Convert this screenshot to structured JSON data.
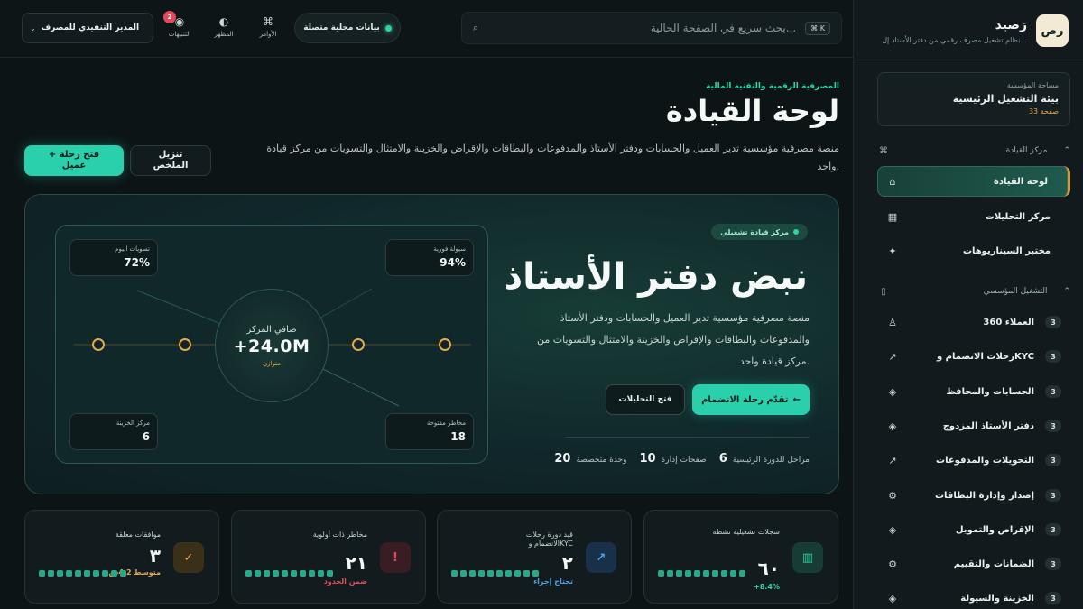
{
  "brand": {
    "name": "رَصيد",
    "logo": "رص",
    "subtitle": "نظام تشغيل مصرف رقمي من دفتر الأستاذ إل..."
  },
  "workspace": {
    "label": "مساحة المؤسسة",
    "name": "بيئة التشغيل الرئيسية",
    "count": "33 صفحة"
  },
  "sidebar": {
    "section_command": {
      "label": "مركز القيادة",
      "icon": "command-icon"
    },
    "command_items": [
      {
        "label": "لوحة القيادة",
        "icon": "dashboard-icon",
        "glyph": "⌂",
        "active": true
      },
      {
        "label": "مركز التحليلات",
        "icon": "analytics-icon",
        "glyph": "▦"
      },
      {
        "label": "مختبر السيناريوهات",
        "icon": "sparkle-icon",
        "glyph": "✦"
      }
    ],
    "section_ops": {
      "label": "التشغيل المؤسسي",
      "icon": "building-icon"
    },
    "ops_items": [
      {
        "label": "العملاء 360",
        "badge": "3",
        "icon": "user-icon",
        "glyph": "♙"
      },
      {
        "label": "رحلات الانضمام وKYC",
        "badge": "3",
        "icon": "arrow-up-right-icon",
        "glyph": "↗"
      },
      {
        "label": "الحسابات والمحافظ",
        "badge": "3",
        "icon": "diamond-icon",
        "glyph": "◈"
      },
      {
        "label": "دفتر الأستاذ المزدوج",
        "badge": "3",
        "icon": "diamond-icon",
        "glyph": "◈"
      },
      {
        "label": "التحويلات والمدفوعات",
        "badge": "3",
        "icon": "arrow-up-right-icon",
        "glyph": "↗"
      },
      {
        "label": "إصدار وإدارة البطاقات",
        "badge": "3",
        "icon": "gear-icon",
        "glyph": "⚙"
      },
      {
        "label": "الإقراض والتمويل",
        "badge": "3",
        "icon": "diamond-icon",
        "glyph": "◈"
      },
      {
        "label": "الضمانات والتقييم",
        "badge": "3",
        "icon": "gear-icon",
        "glyph": "⚙"
      },
      {
        "label": "الخزينة والسيولة",
        "badge": "3",
        "icon": "diamond-icon",
        "glyph": "◈"
      }
    ]
  },
  "topbar": {
    "search_placeholder": "بحث سريع في الصفحة الحالية...",
    "search_shortcut": "⌘ K",
    "live_data_label": "بيانات محلية متصلة",
    "commands_label": "الأوامر",
    "appearance_label": "المظهر",
    "notifications_label": "التنبيهات",
    "notifications_count": "2",
    "role_label": "المدير التنفيذي للمصرف"
  },
  "header": {
    "eyebrow": "المصرفية الرقمية والتقنية المالية",
    "title": "لوحة القيادة",
    "description": "منصة مصرفية مؤسسية تدير العميل والحسابات ودفتر الأستاذ والمدفوعات والبطاقات والإقراض والخزينة والامتثال والتسويات من مركز قيادة واحد.",
    "primary_action": "+ فتح رحلة عميل",
    "secondary_action": "تنزيل الملخص"
  },
  "hero": {
    "chip": "مركز قيادة تشغيلي",
    "title": "نبض دفتر الأستاذ",
    "description": "منصة مصرفية مؤسسية تدير العميل والحسابات ودفتر الأستاذ والمدفوعات والبطاقات والإقراض والخزينة والامتثال والتسويات من مركز قيادة واحد.",
    "primary_action": "تقدّم رحلة الانضمام",
    "primary_arrow": "←",
    "secondary_action": "فتح التحليلات",
    "stats": [
      {
        "value": "20",
        "label": "وحدة متخصصة"
      },
      {
        "value": "10",
        "label": "صفحات إدارة"
      },
      {
        "value": "6",
        "label": "مراحل للدورة الرئيسية"
      }
    ],
    "pulse": {
      "center_label": "صافي المركز",
      "center_value": "+24.0M",
      "center_status": "متوازن",
      "cards": [
        {
          "label": "تسويات اليوم",
          "value": "72%"
        },
        {
          "label": "سيولة فورية",
          "value": "94%"
        },
        {
          "label": "مركز الخزينة",
          "value": "6"
        },
        {
          "label": "مخاطر مفتوحة",
          "value": "18"
        }
      ]
    }
  },
  "kpis": [
    {
      "label": "سجلات تشغيلية نشطة",
      "value": "٦٠",
      "sub": "+8.4%",
      "sub_color": "#2fd3a6",
      "icon": "grid-icon",
      "glyph": "▥",
      "icon_bg": "#173b35",
      "icon_color": "#2fd3a6"
    },
    {
      "label": "قيد دورة رحلات الانضمام وKYC",
      "value": "٢",
      "sub": "تحتاج إجراء",
      "sub_color": "#4ea0e6",
      "icon": "arrow-up-right-icon",
      "glyph": "↗",
      "icon_bg": "#18304a",
      "icon_color": "#4ea0e6"
    },
    {
      "label": "مخاطر ذات أولوية",
      "value": "٢١",
      "sub": "ضمن الحدود",
      "sub_color": "#e24a5a",
      "icon": "alert-icon",
      "glyph": "!",
      "icon_bg": "#3a1c24",
      "icon_color": "#e24a5a"
    },
    {
      "label": "موافقات معلقة",
      "value": "٣",
      "sub": "متوسط 4.2س",
      "sub_color": "#e6a84b",
      "icon": "check-icon",
      "glyph": "✓",
      "icon_bg": "#3a3018",
      "icon_color": "#e6a84b"
    }
  ]
}
